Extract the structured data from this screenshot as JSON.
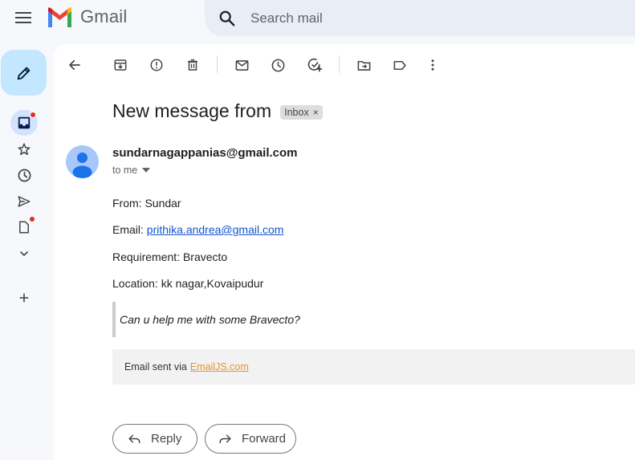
{
  "app": {
    "name": "Gmail"
  },
  "search": {
    "placeholder": "Search mail"
  },
  "toolbar": {
    "actions": [
      "back",
      "archive",
      "report-spam",
      "delete",
      "mark-unread",
      "snooze",
      "add-to-tasks",
      "move-to",
      "labels",
      "more"
    ]
  },
  "email": {
    "subject": "New message from",
    "label": "Inbox",
    "label_remove": "×",
    "sender_email": "sundarnagappanias@gmail.com",
    "recipient": "to me",
    "body": {
      "from_label": "From:",
      "from_value": "Sundar",
      "email_label": "Email:",
      "email_value": "prithika.andrea@gmail.com",
      "requirement_label": "Requirement:",
      "requirement_value": "Bravecto",
      "location_label": "Location:",
      "location_value": "kk nagar,Kovaipudur",
      "quote": "Can u help me with some Bravecto?"
    },
    "footer_text": "Email sent via",
    "footer_link": "EmailJS.com"
  },
  "actions": {
    "reply": "Reply",
    "forward": "Forward"
  },
  "colors": {
    "background": "#f6f8fc",
    "compose": "#c2e7ff",
    "search_bg": "#e9eef6",
    "link": "#1155cc",
    "emailjs_link": "#e8912d",
    "unread_dot": "#d93025"
  }
}
